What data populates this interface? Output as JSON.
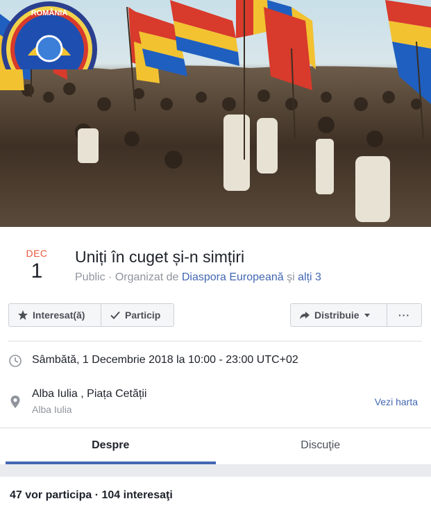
{
  "cover": {
    "badge_text": "ROMÂNIA"
  },
  "event": {
    "month": "DEC",
    "day": "1",
    "title": "Uniți în cuget și-n simțiri",
    "privacy": "Public",
    "organized_prefix": "Organizat de",
    "organizer": "Diaspora Europeană",
    "and_text": "şi",
    "others": "alți 3"
  },
  "actions": {
    "interested_label": "Interesat(ă)",
    "going_label": "Particip",
    "share_label": "Distribuie",
    "more_label": "···"
  },
  "details": {
    "datetime": "Sâmbătă, 1 Decembrie 2018 la 10:00 - 23:00 UTC+02",
    "location_name": "Alba Iulia , Piața Cetății",
    "location_city": "Alba Iulia",
    "map_link": "Vezi harta"
  },
  "tabs": [
    {
      "label": "Despre"
    },
    {
      "label": "Discuţie"
    }
  ],
  "stats": {
    "text": "47 vor participa · 104 interesaţi"
  },
  "colors": {
    "accent": "#4267b2",
    "month": "#e9573f",
    "muted": "#90949c"
  }
}
